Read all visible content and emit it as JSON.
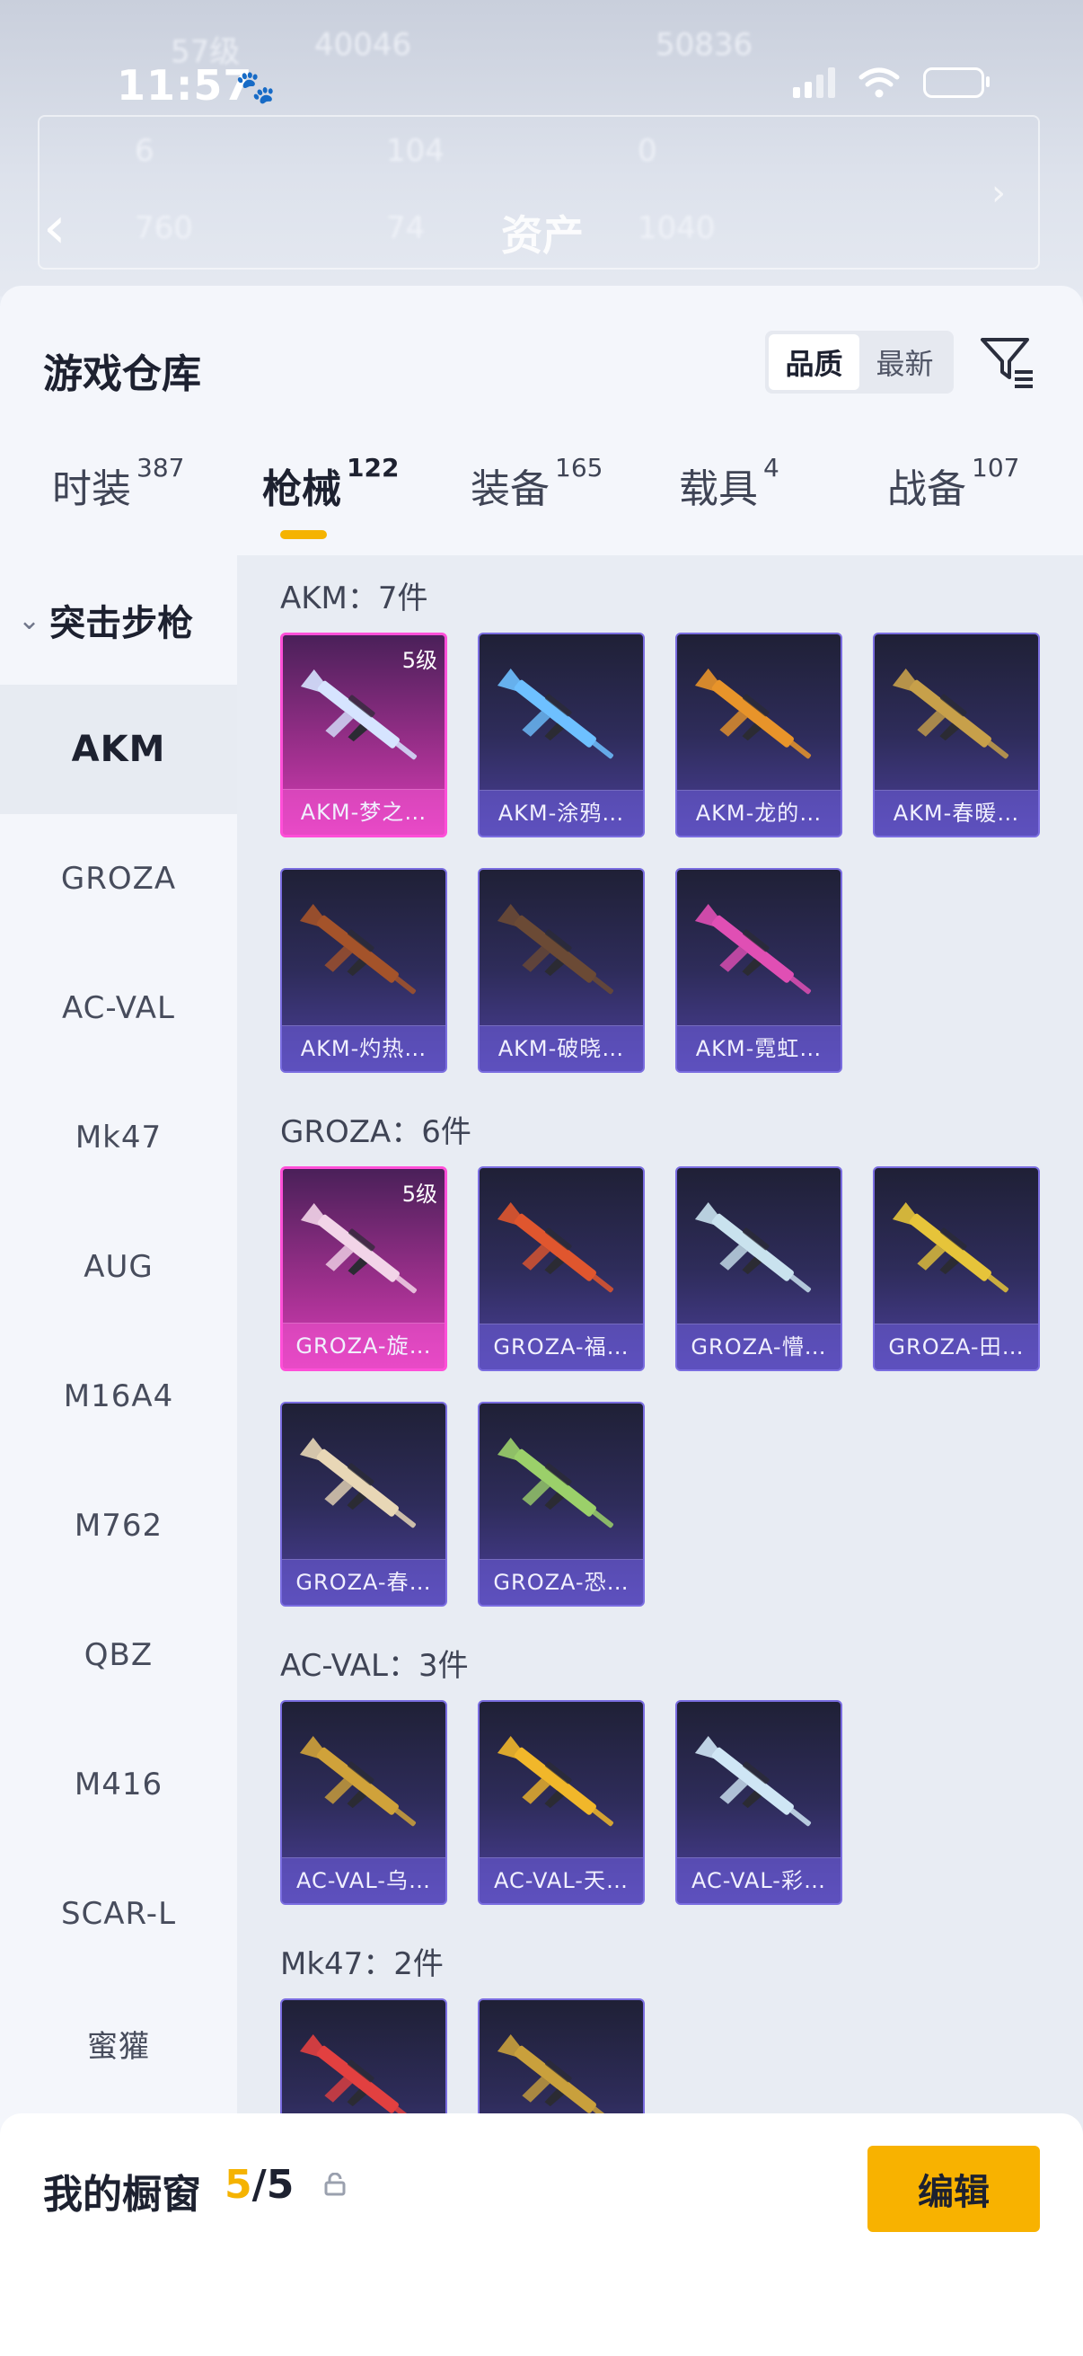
{
  "status_bar": {
    "time": "11:57",
    "paw_icon": "paw-icon"
  },
  "background": {
    "title": "资产",
    "blur_numbers": [
      "57级",
      "40046",
      "50836",
      "6",
      "104",
      "0",
      "760",
      "74",
      "1040"
    ]
  },
  "sheet": {
    "title": "游戏仓库",
    "sort": {
      "options": [
        "品质",
        "最新"
      ],
      "active": 0
    },
    "filter_icon": "filter-icon"
  },
  "tabs": [
    {
      "label": "时装",
      "count": "387"
    },
    {
      "label": "枪械",
      "count": "122"
    },
    {
      "label": "装备",
      "count": "165"
    },
    {
      "label": "载具",
      "count": "4"
    },
    {
      "label": "战备",
      "count": "107"
    }
  ],
  "active_tab": 1,
  "sidebar": {
    "header": "突击步枪",
    "items": [
      "AKM",
      "GROZA",
      "AC-VAL",
      "Mk47",
      "AUG",
      "M16A4",
      "M762",
      "QBZ",
      "M416",
      "SCAR-L",
      "蜜獾"
    ],
    "active": 0
  },
  "groups": [
    {
      "label": "AKM：7件",
      "items": [
        {
          "name": "AKM-梦之…",
          "quality": "pink",
          "level": "5级",
          "gun": "#d6e4ff"
        },
        {
          "name": "AKM-涂鸦…",
          "quality": "purple",
          "gun": "#6ec0ff"
        },
        {
          "name": "AKM-龙的…",
          "quality": "purple",
          "gun": "#e8942a"
        },
        {
          "name": "AKM-春暖…",
          "quality": "purple",
          "gun": "#c7a04a"
        },
        {
          "name": "AKM-灼热…",
          "quality": "purple",
          "gun": "#a4532a"
        },
        {
          "name": "AKM-破晓…",
          "quality": "purple",
          "gun": "#6b4a35"
        },
        {
          "name": "AKM-霓虹…",
          "quality": "purple",
          "gun": "#e04fb4"
        }
      ]
    },
    {
      "label": "GROZA：6件",
      "items": [
        {
          "name": "GROZA-旋…",
          "quality": "pink",
          "level": "5级",
          "gun": "#f2d4e8"
        },
        {
          "name": "GROZA-福…",
          "quality": "purple",
          "gun": "#e0562e"
        },
        {
          "name": "GROZA-懵…",
          "quality": "purple",
          "gun": "#c9e2ee"
        },
        {
          "name": "GROZA-田…",
          "quality": "purple",
          "gun": "#e6c43a"
        },
        {
          "name": "GROZA-春…",
          "quality": "purple",
          "gun": "#e8d7b6"
        },
        {
          "name": "GROZA-恐…",
          "quality": "purple",
          "gun": "#9bd06a"
        }
      ]
    },
    {
      "label": "AC-VAL：3件",
      "items": [
        {
          "name": "AC-VAL-乌…",
          "quality": "purple",
          "gun": "#d0a23a"
        },
        {
          "name": "AC-VAL-天…",
          "quality": "purple",
          "gun": "#f1b72a"
        },
        {
          "name": "AC-VAL-彩…",
          "quality": "purple",
          "gun": "#cfe6f5"
        }
      ]
    },
    {
      "label": "Mk47：2件",
      "items": [
        {
          "name": "",
          "quality": "purple",
          "gun": "#e24040"
        },
        {
          "name": "",
          "quality": "purple",
          "gun": "#c9a03c"
        }
      ]
    }
  ],
  "share_icon": "share-external-icon",
  "window": {
    "label": "我的橱窗",
    "current": "5",
    "separator": "/",
    "total": "5",
    "edit_label": "编辑",
    "lock_icon": "lock-icon"
  }
}
